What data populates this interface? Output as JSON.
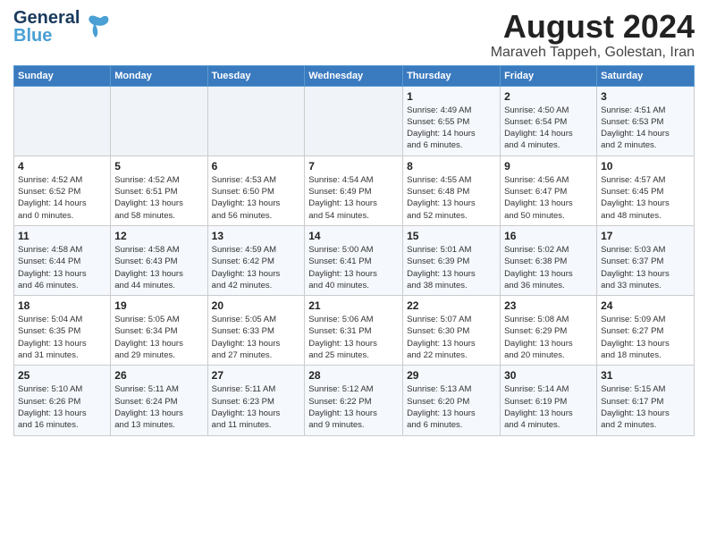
{
  "header": {
    "logo_line1": "General",
    "logo_line2": "Blue",
    "main_title": "August 2024",
    "subtitle": "Maraveh Tappeh, Golestan, Iran"
  },
  "weekdays": [
    "Sunday",
    "Monday",
    "Tuesday",
    "Wednesday",
    "Thursday",
    "Friday",
    "Saturday"
  ],
  "weeks": [
    [
      {
        "day": "",
        "info": ""
      },
      {
        "day": "",
        "info": ""
      },
      {
        "day": "",
        "info": ""
      },
      {
        "day": "",
        "info": ""
      },
      {
        "day": "1",
        "info": "Sunrise: 4:49 AM\nSunset: 6:55 PM\nDaylight: 14 hours\nand 6 minutes."
      },
      {
        "day": "2",
        "info": "Sunrise: 4:50 AM\nSunset: 6:54 PM\nDaylight: 14 hours\nand 4 minutes."
      },
      {
        "day": "3",
        "info": "Sunrise: 4:51 AM\nSunset: 6:53 PM\nDaylight: 14 hours\nand 2 minutes."
      }
    ],
    [
      {
        "day": "4",
        "info": "Sunrise: 4:52 AM\nSunset: 6:52 PM\nDaylight: 14 hours\nand 0 minutes."
      },
      {
        "day": "5",
        "info": "Sunrise: 4:52 AM\nSunset: 6:51 PM\nDaylight: 13 hours\nand 58 minutes."
      },
      {
        "day": "6",
        "info": "Sunrise: 4:53 AM\nSunset: 6:50 PM\nDaylight: 13 hours\nand 56 minutes."
      },
      {
        "day": "7",
        "info": "Sunrise: 4:54 AM\nSunset: 6:49 PM\nDaylight: 13 hours\nand 54 minutes."
      },
      {
        "day": "8",
        "info": "Sunrise: 4:55 AM\nSunset: 6:48 PM\nDaylight: 13 hours\nand 52 minutes."
      },
      {
        "day": "9",
        "info": "Sunrise: 4:56 AM\nSunset: 6:47 PM\nDaylight: 13 hours\nand 50 minutes."
      },
      {
        "day": "10",
        "info": "Sunrise: 4:57 AM\nSunset: 6:45 PM\nDaylight: 13 hours\nand 48 minutes."
      }
    ],
    [
      {
        "day": "11",
        "info": "Sunrise: 4:58 AM\nSunset: 6:44 PM\nDaylight: 13 hours\nand 46 minutes."
      },
      {
        "day": "12",
        "info": "Sunrise: 4:58 AM\nSunset: 6:43 PM\nDaylight: 13 hours\nand 44 minutes."
      },
      {
        "day": "13",
        "info": "Sunrise: 4:59 AM\nSunset: 6:42 PM\nDaylight: 13 hours\nand 42 minutes."
      },
      {
        "day": "14",
        "info": "Sunrise: 5:00 AM\nSunset: 6:41 PM\nDaylight: 13 hours\nand 40 minutes."
      },
      {
        "day": "15",
        "info": "Sunrise: 5:01 AM\nSunset: 6:39 PM\nDaylight: 13 hours\nand 38 minutes."
      },
      {
        "day": "16",
        "info": "Sunrise: 5:02 AM\nSunset: 6:38 PM\nDaylight: 13 hours\nand 36 minutes."
      },
      {
        "day": "17",
        "info": "Sunrise: 5:03 AM\nSunset: 6:37 PM\nDaylight: 13 hours\nand 33 minutes."
      }
    ],
    [
      {
        "day": "18",
        "info": "Sunrise: 5:04 AM\nSunset: 6:35 PM\nDaylight: 13 hours\nand 31 minutes."
      },
      {
        "day": "19",
        "info": "Sunrise: 5:05 AM\nSunset: 6:34 PM\nDaylight: 13 hours\nand 29 minutes."
      },
      {
        "day": "20",
        "info": "Sunrise: 5:05 AM\nSunset: 6:33 PM\nDaylight: 13 hours\nand 27 minutes."
      },
      {
        "day": "21",
        "info": "Sunrise: 5:06 AM\nSunset: 6:31 PM\nDaylight: 13 hours\nand 25 minutes."
      },
      {
        "day": "22",
        "info": "Sunrise: 5:07 AM\nSunset: 6:30 PM\nDaylight: 13 hours\nand 22 minutes."
      },
      {
        "day": "23",
        "info": "Sunrise: 5:08 AM\nSunset: 6:29 PM\nDaylight: 13 hours\nand 20 minutes."
      },
      {
        "day": "24",
        "info": "Sunrise: 5:09 AM\nSunset: 6:27 PM\nDaylight: 13 hours\nand 18 minutes."
      }
    ],
    [
      {
        "day": "25",
        "info": "Sunrise: 5:10 AM\nSunset: 6:26 PM\nDaylight: 13 hours\nand 16 minutes."
      },
      {
        "day": "26",
        "info": "Sunrise: 5:11 AM\nSunset: 6:24 PM\nDaylight: 13 hours\nand 13 minutes."
      },
      {
        "day": "27",
        "info": "Sunrise: 5:11 AM\nSunset: 6:23 PM\nDaylight: 13 hours\nand 11 minutes."
      },
      {
        "day": "28",
        "info": "Sunrise: 5:12 AM\nSunset: 6:22 PM\nDaylight: 13 hours\nand 9 minutes."
      },
      {
        "day": "29",
        "info": "Sunrise: 5:13 AM\nSunset: 6:20 PM\nDaylight: 13 hours\nand 6 minutes."
      },
      {
        "day": "30",
        "info": "Sunrise: 5:14 AM\nSunset: 6:19 PM\nDaylight: 13 hours\nand 4 minutes."
      },
      {
        "day": "31",
        "info": "Sunrise: 5:15 AM\nSunset: 6:17 PM\nDaylight: 13 hours\nand 2 minutes."
      }
    ]
  ]
}
